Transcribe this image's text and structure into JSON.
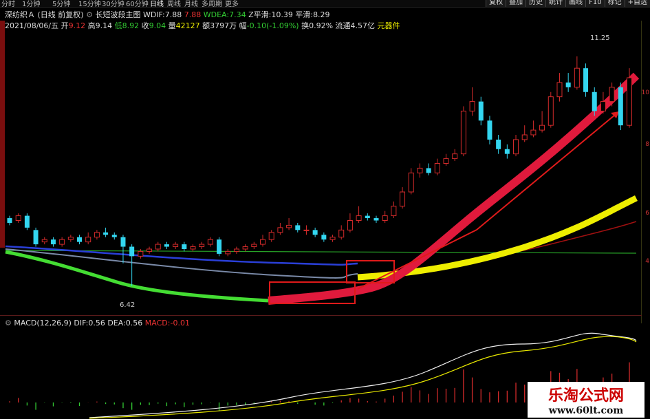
{
  "toolbar": {
    "timeframes": [
      "分时",
      "1分钟",
      "5分钟",
      "15分钟",
      "30分钟",
      "60分钟",
      "日线",
      "周线",
      "月线",
      "多周期",
      "更多"
    ],
    "active_timeframe": "日线",
    "buttons": [
      "复权",
      "叠加",
      "历史",
      "统计",
      "画线",
      "F10",
      "标记",
      "+自选"
    ]
  },
  "header": {
    "stock_name": "深纺织Ａ",
    "period_note": "(日线 前复权)",
    "indicator_name": "长短波段主图",
    "wdif_label": "WDIF:",
    "wdif_value": "7.88",
    "wdif_value2": "7.88",
    "wdea_label": "WDEA:",
    "wdea_value": "7.34",
    "zping_label": "Z平滑:",
    "zping_value": "10.39",
    "ping_label": "平滑:",
    "ping_value": "8.29"
  },
  "quote": {
    "date": "2021/08/06/五",
    "open_label": "开",
    "open": "9.12",
    "high_label": "高",
    "high": "9.14",
    "low_label": "低",
    "low": "8.92",
    "close_label": "收",
    "close": "9.04",
    "volume_label": "量",
    "volume": "42127",
    "amount_label": "额",
    "amount": "3797万",
    "change_label": "幅",
    "change": "-0.10(-1.09%)",
    "turnover_label": "换",
    "turnover": "0.92%",
    "float_label": "流通",
    "float_value": "4.57亿",
    "sector": "元器件"
  },
  "chart_annotations": {
    "high_label": "11.25",
    "low_label": "6.42"
  },
  "right_axis": [
    "10",
    "8",
    "6",
    "4"
  ],
  "macd": {
    "title": "MACD(12,26,9)",
    "dif_label": "DIF:",
    "dif_value": "0.56",
    "dea_label": "DEA:",
    "dea_value": "0.56",
    "macd_label": "MACD:",
    "macd_value": "-0.01"
  },
  "watermark": {
    "name": "乐淘公式网",
    "url": "www.60lt.com"
  },
  "colors": {
    "up": "#d42b2b",
    "down": "#33d6f0",
    "green_line": "#33cc33",
    "yellow_band": "#eeee00",
    "red_band": "#e01a3c",
    "blue_line": "#2a3fd8"
  },
  "chart_data": {
    "type": "candlestick",
    "ylim": [
      6,
      12
    ],
    "candles": [
      {
        "o": 7.85,
        "c": 7.75,
        "h": 7.9,
        "l": 7.7
      },
      {
        "o": 7.8,
        "c": 7.9,
        "h": 7.95,
        "l": 7.75
      },
      {
        "o": 7.9,
        "c": 7.65,
        "h": 7.95,
        "l": 7.6
      },
      {
        "o": 7.6,
        "c": 7.3,
        "h": 7.65,
        "l": 7.25
      },
      {
        "o": 7.35,
        "c": 7.4,
        "h": 7.45,
        "l": 7.3
      },
      {
        "o": 7.4,
        "c": 7.3,
        "h": 7.45,
        "l": 7.25
      },
      {
        "o": 7.3,
        "c": 7.4,
        "h": 7.45,
        "l": 7.25
      },
      {
        "o": 7.4,
        "c": 7.45,
        "h": 7.5,
        "l": 7.35
      },
      {
        "o": 7.45,
        "c": 7.35,
        "h": 7.5,
        "l": 7.3
      },
      {
        "o": 7.35,
        "c": 7.45,
        "h": 7.55,
        "l": 7.3
      },
      {
        "o": 7.45,
        "c": 7.55,
        "h": 7.6,
        "l": 7.4
      },
      {
        "o": 7.55,
        "c": 7.5,
        "h": 7.65,
        "l": 7.45
      },
      {
        "o": 7.5,
        "c": 7.45,
        "h": 7.55,
        "l": 7.4
      },
      {
        "o": 7.45,
        "c": 7.25,
        "h": 7.5,
        "l": 6.9
      },
      {
        "o": 7.25,
        "c": 7.05,
        "h": 7.3,
        "l": 6.42
      },
      {
        "o": 7.05,
        "c": 7.15,
        "h": 7.2,
        "l": 7.0
      },
      {
        "o": 7.15,
        "c": 7.2,
        "h": 7.25,
        "l": 7.1
      },
      {
        "o": 7.2,
        "c": 7.3,
        "h": 7.35,
        "l": 7.15
      },
      {
        "o": 7.3,
        "c": 7.25,
        "h": 7.35,
        "l": 7.2
      },
      {
        "o": 7.25,
        "c": 7.3,
        "h": 7.35,
        "l": 7.2
      },
      {
        "o": 7.3,
        "c": 7.2,
        "h": 7.35,
        "l": 7.15
      },
      {
        "o": 7.2,
        "c": 7.25,
        "h": 7.3,
        "l": 7.15
      },
      {
        "o": 7.25,
        "c": 7.3,
        "h": 7.35,
        "l": 7.2
      },
      {
        "o": 7.3,
        "c": 7.4,
        "h": 7.45,
        "l": 7.25
      },
      {
        "o": 7.4,
        "c": 7.1,
        "h": 7.45,
        "l": 7.05
      },
      {
        "o": 7.1,
        "c": 7.15,
        "h": 7.2,
        "l": 7.05
      },
      {
        "o": 7.15,
        "c": 7.2,
        "h": 7.25,
        "l": 7.1
      },
      {
        "o": 7.2,
        "c": 7.25,
        "h": 7.3,
        "l": 7.15
      },
      {
        "o": 7.25,
        "c": 7.3,
        "h": 7.35,
        "l": 7.2
      },
      {
        "o": 7.3,
        "c": 7.4,
        "h": 7.5,
        "l": 7.25
      },
      {
        "o": 7.4,
        "c": 7.55,
        "h": 7.6,
        "l": 7.35
      },
      {
        "o": 7.55,
        "c": 7.65,
        "h": 7.75,
        "l": 7.5
      },
      {
        "o": 7.65,
        "c": 7.7,
        "h": 7.85,
        "l": 7.6
      },
      {
        "o": 7.7,
        "c": 7.6,
        "h": 7.75,
        "l": 7.55
      },
      {
        "o": 7.6,
        "c": 7.6,
        "h": 7.7,
        "l": 7.5
      },
      {
        "o": 7.6,
        "c": 7.5,
        "h": 7.65,
        "l": 7.45
      },
      {
        "o": 7.5,
        "c": 7.4,
        "h": 7.55,
        "l": 7.35
      },
      {
        "o": 7.4,
        "c": 7.45,
        "h": 7.5,
        "l": 7.35
      },
      {
        "o": 7.45,
        "c": 7.6,
        "h": 7.7,
        "l": 7.4
      },
      {
        "o": 7.6,
        "c": 7.8,
        "h": 7.95,
        "l": 7.55
      },
      {
        "o": 7.8,
        "c": 7.9,
        "h": 8.1,
        "l": 7.75
      },
      {
        "o": 7.9,
        "c": 7.85,
        "h": 7.95,
        "l": 7.8
      },
      {
        "o": 7.85,
        "c": 7.8,
        "h": 7.9,
        "l": 7.75
      },
      {
        "o": 7.8,
        "c": 7.9,
        "h": 8.0,
        "l": 7.75
      },
      {
        "o": 7.9,
        "c": 8.1,
        "h": 8.2,
        "l": 7.85
      },
      {
        "o": 8.1,
        "c": 8.4,
        "h": 8.5,
        "l": 8.05
      },
      {
        "o": 8.4,
        "c": 8.8,
        "h": 8.9,
        "l": 8.35
      },
      {
        "o": 8.8,
        "c": 8.9,
        "h": 9.0,
        "l": 8.7
      },
      {
        "o": 8.9,
        "c": 8.8,
        "h": 9.0,
        "l": 8.75
      },
      {
        "o": 8.8,
        "c": 9.0,
        "h": 9.1,
        "l": 8.75
      },
      {
        "o": 9.0,
        "c": 9.1,
        "h": 9.2,
        "l": 8.95
      },
      {
        "o": 9.1,
        "c": 9.2,
        "h": 9.3,
        "l": 9.05
      },
      {
        "o": 9.2,
        "c": 10.1,
        "h": 10.2,
        "l": 9.15
      },
      {
        "o": 10.1,
        "c": 10.3,
        "h": 10.6,
        "l": 10.0
      },
      {
        "o": 10.3,
        "c": 9.9,
        "h": 10.4,
        "l": 9.8
      },
      {
        "o": 9.9,
        "c": 9.5,
        "h": 10.0,
        "l": 9.4
      },
      {
        "o": 9.5,
        "c": 9.3,
        "h": 9.6,
        "l": 9.2
      },
      {
        "o": 9.3,
        "c": 9.2,
        "h": 9.4,
        "l": 9.1
      },
      {
        "o": 9.2,
        "c": 9.5,
        "h": 9.6,
        "l": 9.15
      },
      {
        "o": 9.5,
        "c": 9.6,
        "h": 9.8,
        "l": 9.45
      },
      {
        "o": 9.6,
        "c": 9.7,
        "h": 9.9,
        "l": 9.55
      },
      {
        "o": 9.7,
        "c": 9.8,
        "h": 10.1,
        "l": 9.65
      },
      {
        "o": 9.8,
        "c": 10.4,
        "h": 10.5,
        "l": 9.75
      },
      {
        "o": 10.4,
        "c": 10.7,
        "h": 10.9,
        "l": 10.3
      },
      {
        "o": 10.7,
        "c": 10.6,
        "h": 10.9,
        "l": 10.5
      },
      {
        "o": 10.6,
        "c": 11.0,
        "h": 11.25,
        "l": 10.55
      },
      {
        "o": 11.0,
        "c": 10.5,
        "h": 11.1,
        "l": 10.4
      },
      {
        "o": 10.5,
        "c": 10.1,
        "h": 10.6,
        "l": 10.0
      },
      {
        "o": 10.1,
        "c": 10.3,
        "h": 10.5,
        "l": 10.05
      },
      {
        "o": 10.3,
        "c": 10.6,
        "h": 10.7,
        "l": 10.2
      },
      {
        "o": 10.6,
        "c": 9.8,
        "h": 10.7,
        "l": 9.7
      },
      {
        "o": 9.8,
        "c": 10.8,
        "h": 11.0,
        "l": 9.75
      }
    ]
  }
}
